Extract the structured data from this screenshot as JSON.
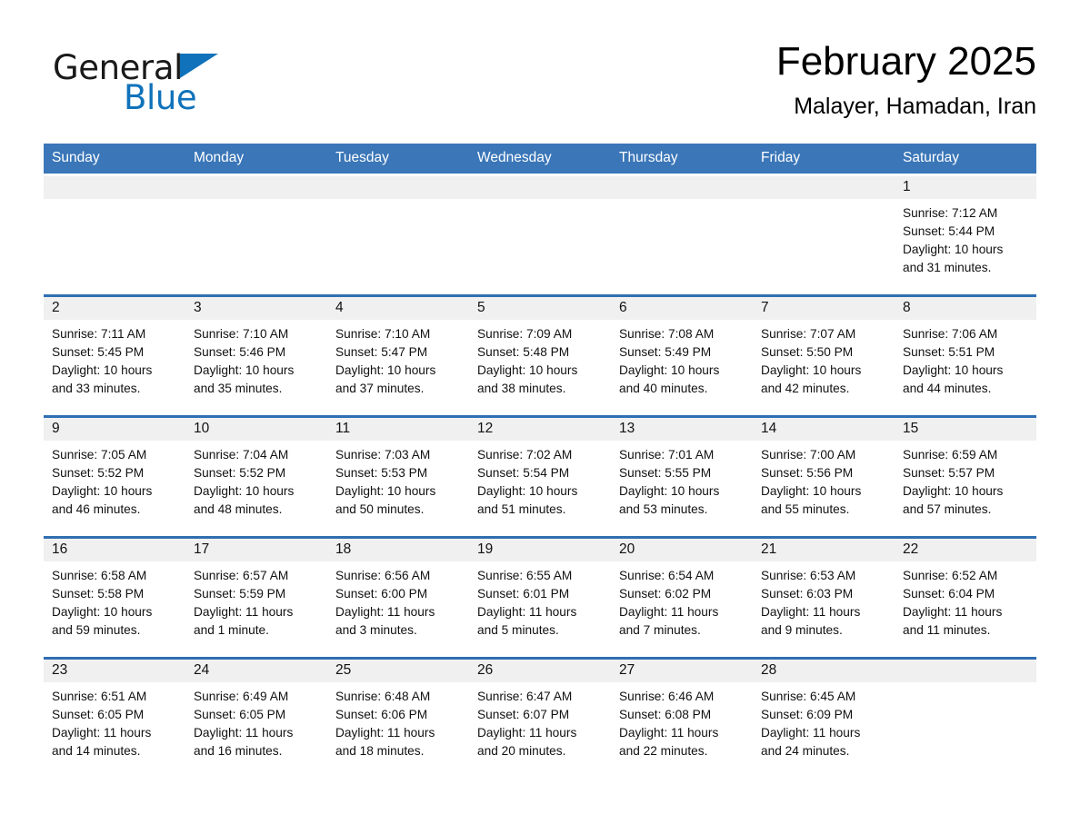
{
  "brand": {
    "word1": "General",
    "word2": "Blue",
    "triangle_color": "#0f72ba"
  },
  "header": {
    "month_title": "February 2025",
    "location": "Malayer, Hamadan, Iran",
    "header_bg": "#3a76b8",
    "separator_color": "#2f6fb2",
    "daynum_band_bg": "#f0f0f0"
  },
  "weekday_headers": [
    "Sunday",
    "Monday",
    "Tuesday",
    "Wednesday",
    "Thursday",
    "Friday",
    "Saturday"
  ],
  "weeks": [
    {
      "days": [
        {
          "num": "",
          "sunrise": "",
          "sunset": "",
          "daylight1": "",
          "daylight2": "",
          "empty": true
        },
        {
          "num": "",
          "sunrise": "",
          "sunset": "",
          "daylight1": "",
          "daylight2": "",
          "empty": true
        },
        {
          "num": "",
          "sunrise": "",
          "sunset": "",
          "daylight1": "",
          "daylight2": "",
          "empty": true
        },
        {
          "num": "",
          "sunrise": "",
          "sunset": "",
          "daylight1": "",
          "daylight2": "",
          "empty": true
        },
        {
          "num": "",
          "sunrise": "",
          "sunset": "",
          "daylight1": "",
          "daylight2": "",
          "empty": true
        },
        {
          "num": "",
          "sunrise": "",
          "sunset": "",
          "daylight1": "",
          "daylight2": "",
          "empty": true
        },
        {
          "num": "1",
          "sunrise": "Sunrise: 7:12 AM",
          "sunset": "Sunset: 5:44 PM",
          "daylight1": "Daylight: 10 hours",
          "daylight2": "and 31 minutes.",
          "empty": false
        }
      ]
    },
    {
      "days": [
        {
          "num": "2",
          "sunrise": "Sunrise: 7:11 AM",
          "sunset": "Sunset: 5:45 PM",
          "daylight1": "Daylight: 10 hours",
          "daylight2": "and 33 minutes.",
          "empty": false
        },
        {
          "num": "3",
          "sunrise": "Sunrise: 7:10 AM",
          "sunset": "Sunset: 5:46 PM",
          "daylight1": "Daylight: 10 hours",
          "daylight2": "and 35 minutes.",
          "empty": false
        },
        {
          "num": "4",
          "sunrise": "Sunrise: 7:10 AM",
          "sunset": "Sunset: 5:47 PM",
          "daylight1": "Daylight: 10 hours",
          "daylight2": "and 37 minutes.",
          "empty": false
        },
        {
          "num": "5",
          "sunrise": "Sunrise: 7:09 AM",
          "sunset": "Sunset: 5:48 PM",
          "daylight1": "Daylight: 10 hours",
          "daylight2": "and 38 minutes.",
          "empty": false
        },
        {
          "num": "6",
          "sunrise": "Sunrise: 7:08 AM",
          "sunset": "Sunset: 5:49 PM",
          "daylight1": "Daylight: 10 hours",
          "daylight2": "and 40 minutes.",
          "empty": false
        },
        {
          "num": "7",
          "sunrise": "Sunrise: 7:07 AM",
          "sunset": "Sunset: 5:50 PM",
          "daylight1": "Daylight: 10 hours",
          "daylight2": "and 42 minutes.",
          "empty": false
        },
        {
          "num": "8",
          "sunrise": "Sunrise: 7:06 AM",
          "sunset": "Sunset: 5:51 PM",
          "daylight1": "Daylight: 10 hours",
          "daylight2": "and 44 minutes.",
          "empty": false
        }
      ]
    },
    {
      "days": [
        {
          "num": "9",
          "sunrise": "Sunrise: 7:05 AM",
          "sunset": "Sunset: 5:52 PM",
          "daylight1": "Daylight: 10 hours",
          "daylight2": "and 46 minutes.",
          "empty": false
        },
        {
          "num": "10",
          "sunrise": "Sunrise: 7:04 AM",
          "sunset": "Sunset: 5:52 PM",
          "daylight1": "Daylight: 10 hours",
          "daylight2": "and 48 minutes.",
          "empty": false
        },
        {
          "num": "11",
          "sunrise": "Sunrise: 7:03 AM",
          "sunset": "Sunset: 5:53 PM",
          "daylight1": "Daylight: 10 hours",
          "daylight2": "and 50 minutes.",
          "empty": false
        },
        {
          "num": "12",
          "sunrise": "Sunrise: 7:02 AM",
          "sunset": "Sunset: 5:54 PM",
          "daylight1": "Daylight: 10 hours",
          "daylight2": "and 51 minutes.",
          "empty": false
        },
        {
          "num": "13",
          "sunrise": "Sunrise: 7:01 AM",
          "sunset": "Sunset: 5:55 PM",
          "daylight1": "Daylight: 10 hours",
          "daylight2": "and 53 minutes.",
          "empty": false
        },
        {
          "num": "14",
          "sunrise": "Sunrise: 7:00 AM",
          "sunset": "Sunset: 5:56 PM",
          "daylight1": "Daylight: 10 hours",
          "daylight2": "and 55 minutes.",
          "empty": false
        },
        {
          "num": "15",
          "sunrise": "Sunrise: 6:59 AM",
          "sunset": "Sunset: 5:57 PM",
          "daylight1": "Daylight: 10 hours",
          "daylight2": "and 57 minutes.",
          "empty": false
        }
      ]
    },
    {
      "days": [
        {
          "num": "16",
          "sunrise": "Sunrise: 6:58 AM",
          "sunset": "Sunset: 5:58 PM",
          "daylight1": "Daylight: 10 hours",
          "daylight2": "and 59 minutes.",
          "empty": false
        },
        {
          "num": "17",
          "sunrise": "Sunrise: 6:57 AM",
          "sunset": "Sunset: 5:59 PM",
          "daylight1": "Daylight: 11 hours",
          "daylight2": "and 1 minute.",
          "empty": false
        },
        {
          "num": "18",
          "sunrise": "Sunrise: 6:56 AM",
          "sunset": "Sunset: 6:00 PM",
          "daylight1": "Daylight: 11 hours",
          "daylight2": "and 3 minutes.",
          "empty": false
        },
        {
          "num": "19",
          "sunrise": "Sunrise: 6:55 AM",
          "sunset": "Sunset: 6:01 PM",
          "daylight1": "Daylight: 11 hours",
          "daylight2": "and 5 minutes.",
          "empty": false
        },
        {
          "num": "20",
          "sunrise": "Sunrise: 6:54 AM",
          "sunset": "Sunset: 6:02 PM",
          "daylight1": "Daylight: 11 hours",
          "daylight2": "and 7 minutes.",
          "empty": false
        },
        {
          "num": "21",
          "sunrise": "Sunrise: 6:53 AM",
          "sunset": "Sunset: 6:03 PM",
          "daylight1": "Daylight: 11 hours",
          "daylight2": "and 9 minutes.",
          "empty": false
        },
        {
          "num": "22",
          "sunrise": "Sunrise: 6:52 AM",
          "sunset": "Sunset: 6:04 PM",
          "daylight1": "Daylight: 11 hours",
          "daylight2": "and 11 minutes.",
          "empty": false
        }
      ]
    },
    {
      "days": [
        {
          "num": "23",
          "sunrise": "Sunrise: 6:51 AM",
          "sunset": "Sunset: 6:05 PM",
          "daylight1": "Daylight: 11 hours",
          "daylight2": "and 14 minutes.",
          "empty": false
        },
        {
          "num": "24",
          "sunrise": "Sunrise: 6:49 AM",
          "sunset": "Sunset: 6:05 PM",
          "daylight1": "Daylight: 11 hours",
          "daylight2": "and 16 minutes.",
          "empty": false
        },
        {
          "num": "25",
          "sunrise": "Sunrise: 6:48 AM",
          "sunset": "Sunset: 6:06 PM",
          "daylight1": "Daylight: 11 hours",
          "daylight2": "and 18 minutes.",
          "empty": false
        },
        {
          "num": "26",
          "sunrise": "Sunrise: 6:47 AM",
          "sunset": "Sunset: 6:07 PM",
          "daylight1": "Daylight: 11 hours",
          "daylight2": "and 20 minutes.",
          "empty": false
        },
        {
          "num": "27",
          "sunrise": "Sunrise: 6:46 AM",
          "sunset": "Sunset: 6:08 PM",
          "daylight1": "Daylight: 11 hours",
          "daylight2": "and 22 minutes.",
          "empty": false
        },
        {
          "num": "28",
          "sunrise": "Sunrise: 6:45 AM",
          "sunset": "Sunset: 6:09 PM",
          "daylight1": "Daylight: 11 hours",
          "daylight2": "and 24 minutes.",
          "empty": false
        },
        {
          "num": "",
          "sunrise": "",
          "sunset": "",
          "daylight1": "",
          "daylight2": "",
          "empty": true
        }
      ]
    }
  ]
}
